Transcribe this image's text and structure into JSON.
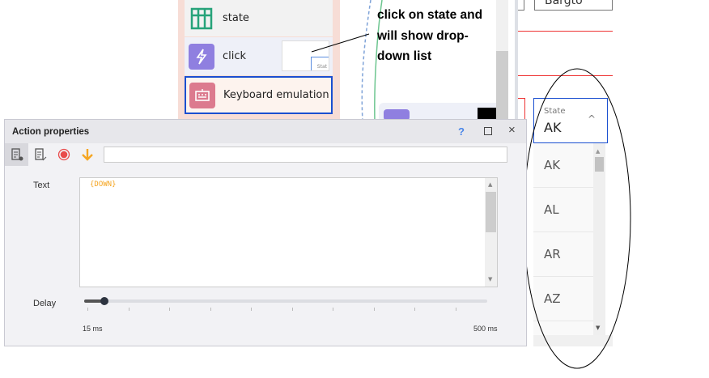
{
  "left_panel": {
    "items": [
      {
        "label": "state"
      },
      {
        "label": "click",
        "thumb_text": "Stat"
      },
      {
        "label": "Keyboard emulation"
      }
    ]
  },
  "annotation": {
    "lines": [
      "click on state and",
      "will show drop-",
      "down list"
    ]
  },
  "form": {
    "top_field_value": "Bargto",
    "state_label": "State",
    "state_value": "AK",
    "options": [
      "AK",
      "AL",
      "AR",
      "AZ"
    ]
  },
  "dialog": {
    "title": "Action properties",
    "help": "?",
    "search_value": "",
    "text_label": "Text",
    "text_value": "{DOWN}",
    "delay_label": "Delay",
    "delay_min": "15 ms",
    "delay_max": "500 ms",
    "delay_value_fraction": 0.04
  },
  "colors": {
    "accent": "#1a4fd0",
    "text_value": "#f5a623",
    "record": "#e94b4b",
    "arrow": "#f5a623"
  }
}
